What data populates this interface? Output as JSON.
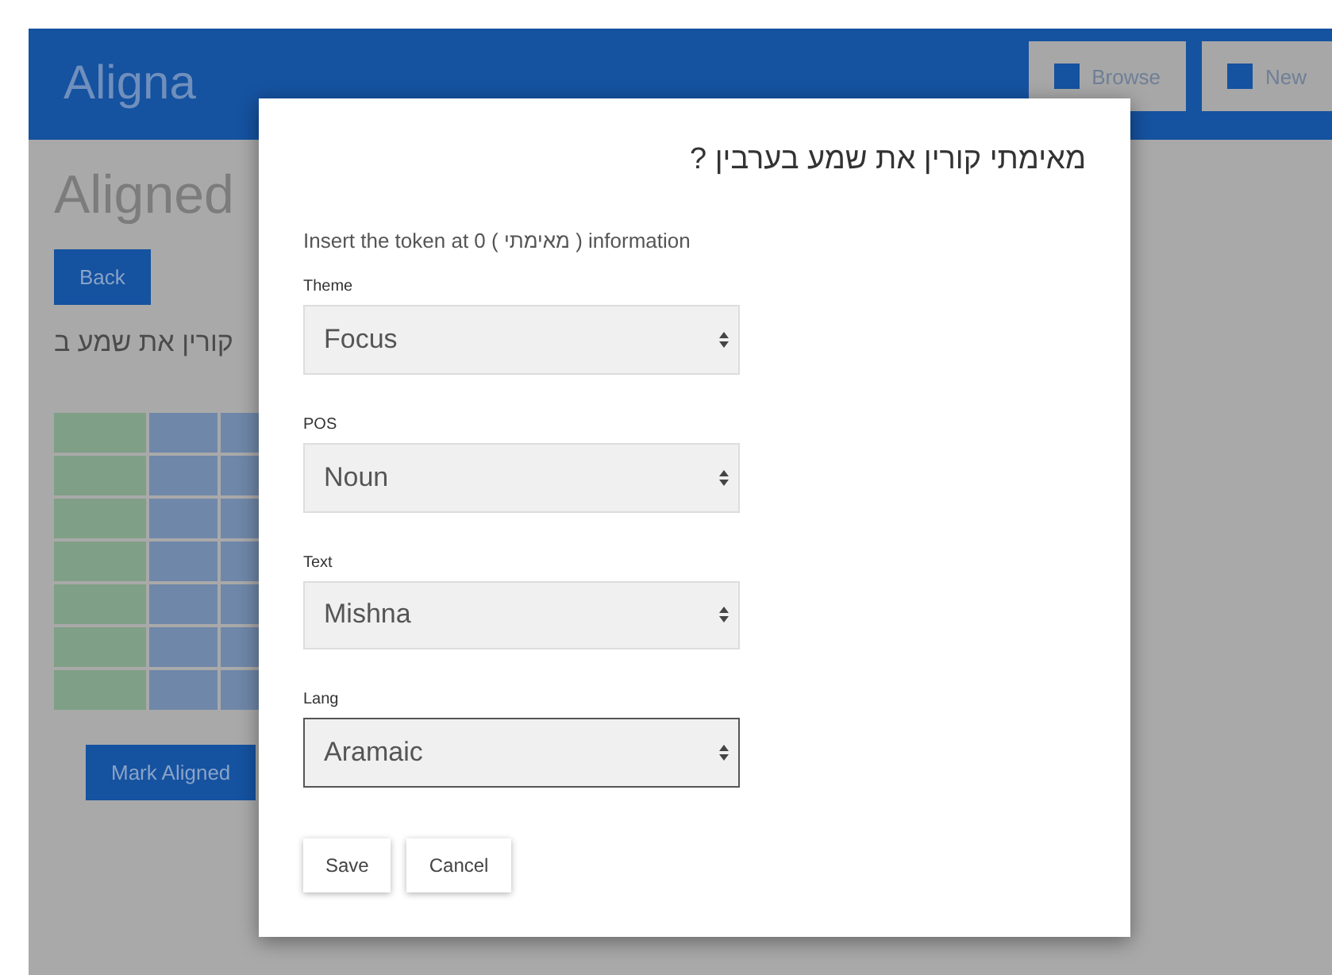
{
  "header": {
    "logo": "Aligna",
    "buttons": [
      {
        "label": "Browse"
      },
      {
        "label": "New"
      }
    ]
  },
  "page": {
    "title": "Aligned",
    "back_button": "Back",
    "heading": "קורין את שמע ב",
    "action_button": "Mark Aligned"
  },
  "dialog": {
    "title": "מאימתי קורין את שמע בערבין ?",
    "instruction": "Insert the token at 0 ( מאימתי ) information",
    "fields": [
      {
        "label": "Theme",
        "value": "Focus",
        "focused": false
      },
      {
        "label": "POS",
        "value": "Noun",
        "focused": false
      },
      {
        "label": "Text",
        "value": "Mishna",
        "focused": false
      },
      {
        "label": "Lang",
        "value": "Aramaic",
        "focused": true
      }
    ],
    "buttons": [
      "Save",
      "Cancel"
    ]
  }
}
